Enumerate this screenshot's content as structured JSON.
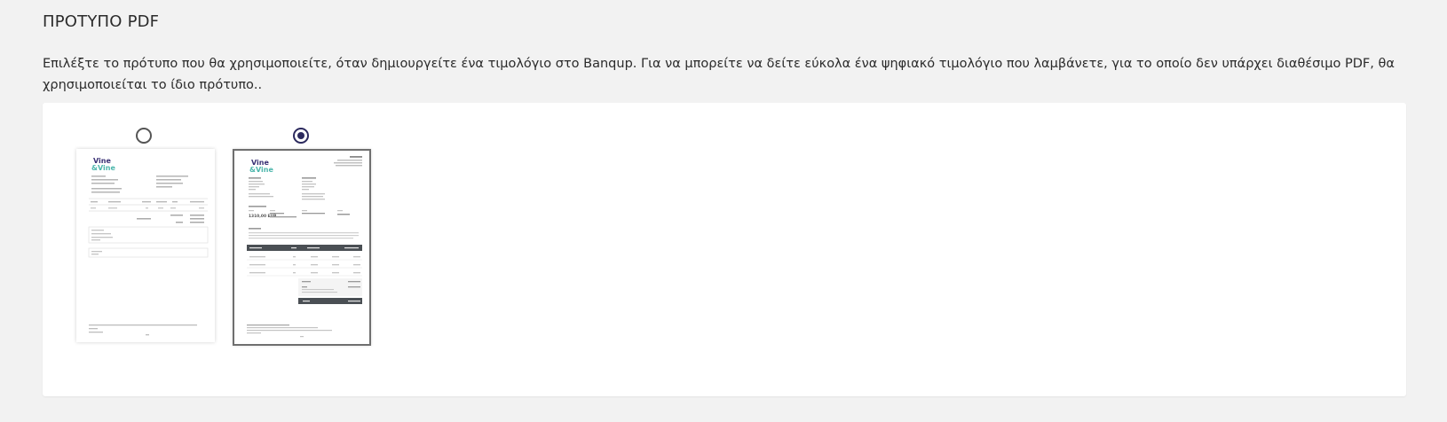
{
  "section": {
    "title": "ΠΡΟΤΥΠΟ PDF",
    "description": "Επιλέξτε το πρότυπο που θα χρησιμοποιείτε, όταν δημιουργείτε ένα τιμολόγιο στο Banqup. Για να μπορείτε να δείτε εύκολα ένα ψηφιακό τιμολόγιο που λαμβάνετε, για το οποίο δεν υπάρχει διαθέσιμο PDF, θα χρησιμοποιείται το ίδιο πρότυπο.."
  },
  "templates": [
    {
      "selected": false,
      "logo_line1": "Vine",
      "logo_line2": "&Vine"
    },
    {
      "selected": true,
      "logo_line1": "Vine",
      "logo_line2": "&Vine",
      "total_amount": "1310,00 EUR"
    }
  ],
  "colors": {
    "radio_checked": "#2c2a5e",
    "logo_purple": "#3a3175",
    "logo_teal": "#4db6ac",
    "table_header": "#4a4f54"
  }
}
